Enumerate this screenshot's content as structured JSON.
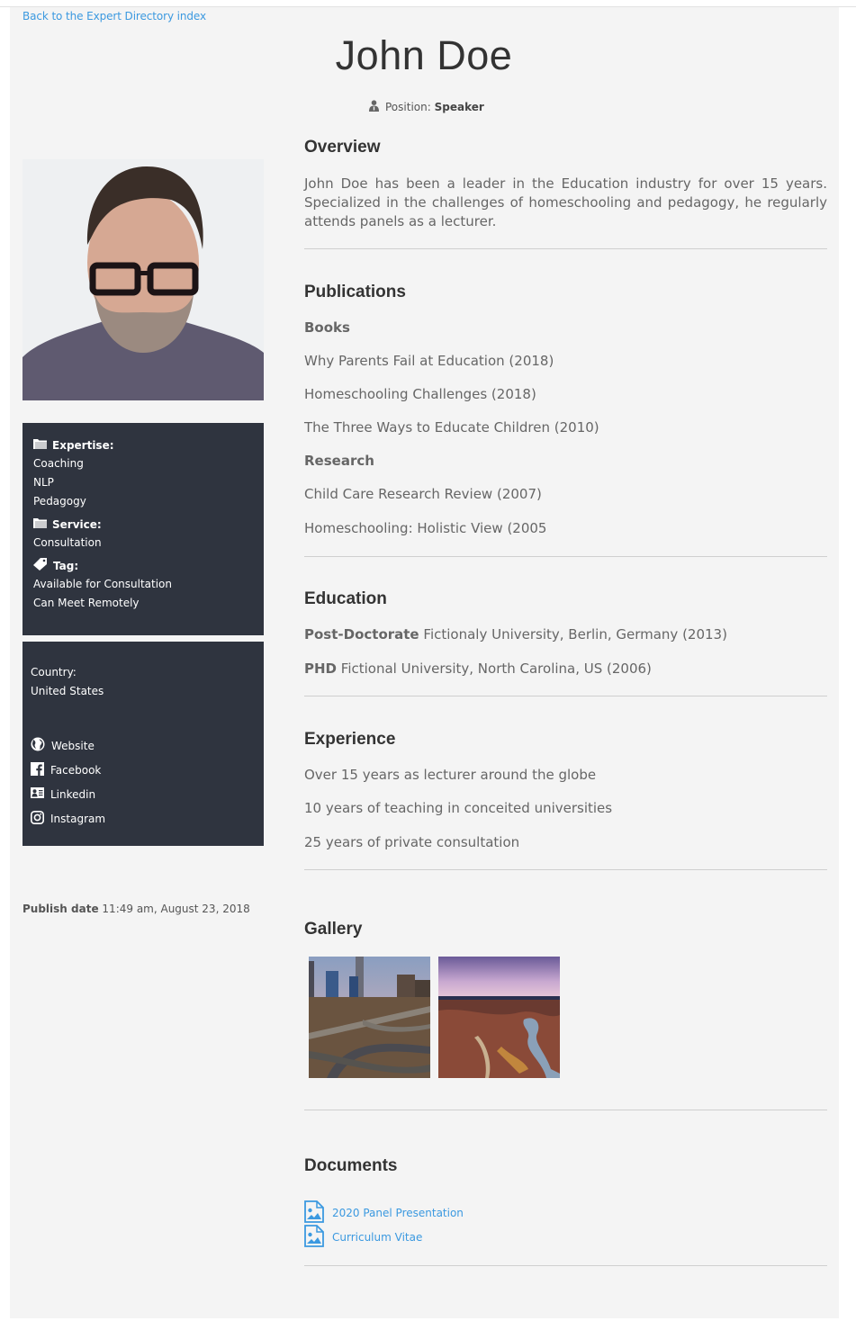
{
  "nav": {
    "back_link": "Back to the Expert Directory index"
  },
  "profile": {
    "name": "John Doe",
    "position_label": "Position",
    "position_value": "Speaker"
  },
  "sidebar": {
    "expertise": {
      "label": "Expertise:",
      "items": [
        "Coaching",
        "NLP",
        "Pedagogy"
      ]
    },
    "service": {
      "label": "Service:",
      "items": [
        "Consultation"
      ]
    },
    "tag": {
      "label": "Tag:",
      "items": [
        "Available for Consultation",
        "Can Meet Remotely"
      ]
    },
    "country": {
      "label": "Country:",
      "value": "United States"
    },
    "social": [
      {
        "icon": "globe-icon",
        "label": "Website"
      },
      {
        "icon": "facebook-icon",
        "label": "Facebook"
      },
      {
        "icon": "linkedin-icon",
        "label": "Linkedin"
      },
      {
        "icon": "instagram-icon",
        "label": "Instagram"
      }
    ],
    "publish_label": "Publish date",
    "publish_value": "11:49 am, August 23, 2018"
  },
  "overview": {
    "title": "Overview",
    "text": "John Doe has been a leader in the Education industry for over 15 years. Specialized in the challenges of homeschooling and pedagogy, he regularly attends panels as a lecturer."
  },
  "publications": {
    "title": "Publications",
    "books_label": "Books",
    "books": [
      "Why Parents Fail at Education (2018)",
      "Homeschooling Challenges (2018)",
      "The Three Ways to Educate Children (2010)"
    ],
    "research_label": "Research",
    "research": [
      "Child Care Research Review (2007)",
      "Homeschooling: Holistic View (2005"
    ]
  },
  "education": {
    "title": "Education",
    "items": [
      {
        "degree": "Post-Doctorate",
        "detail": "Fictionaly University, Berlin, Germany (2013)"
      },
      {
        "degree": "PHD",
        "detail": "Fictional University, North Carolina, US (2006)"
      }
    ]
  },
  "experience": {
    "title": "Experience",
    "items": [
      "Over 15 years as lecturer around the globe",
      "10 years of teaching in conceited universities",
      "25 years of private consultation"
    ]
  },
  "gallery": {
    "title": "Gallery",
    "images": [
      {
        "alt": "city-highway-interchange-photo"
      },
      {
        "alt": "forest-river-aerial-photo"
      }
    ]
  },
  "documents": {
    "title": "Documents",
    "items": [
      "2020 Panel Presentation",
      "Curriculum Vitae"
    ]
  },
  "colors": {
    "accent": "#3b99e0",
    "sidebar_bg": "#2f343f",
    "page_bg": "#f4f4f4"
  }
}
